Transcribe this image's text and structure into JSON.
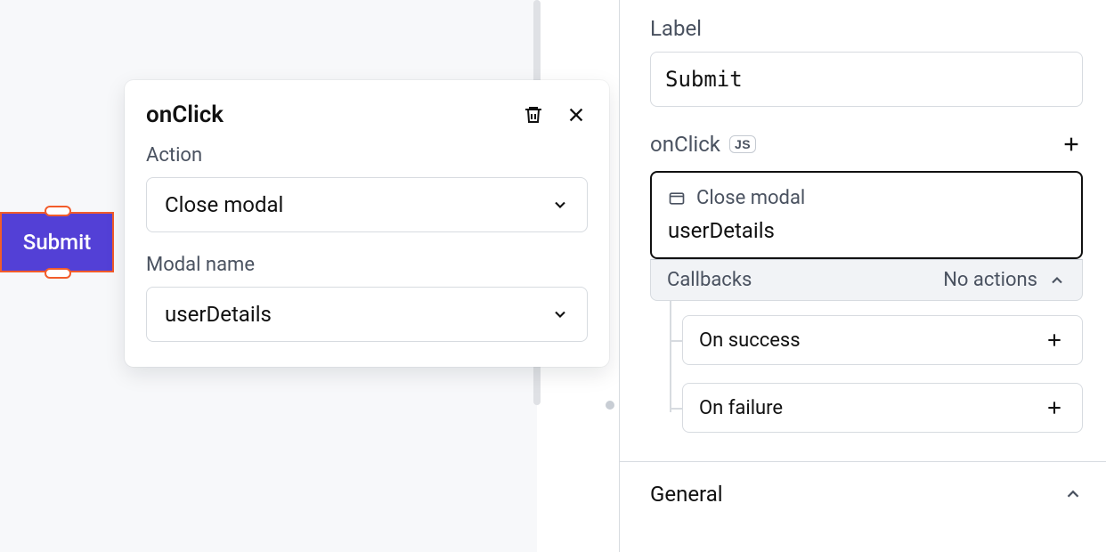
{
  "canvas": {
    "submit_button_label": "Submit"
  },
  "popover": {
    "title": "onClick",
    "action_label": "Action",
    "action_value": "Close modal",
    "modal_name_label": "Modal name",
    "modal_name_value": "userDetails"
  },
  "sidepanel": {
    "label_heading": "Label",
    "label_value": "Submit",
    "onclick_heading": "onClick",
    "js_badge": "JS",
    "action_card": {
      "type_label": "Close modal",
      "value": "userDetails"
    },
    "callbacks": {
      "label": "Callbacks",
      "status": "No actions",
      "on_success": "On success",
      "on_failure": "On failure"
    },
    "general_heading": "General"
  }
}
